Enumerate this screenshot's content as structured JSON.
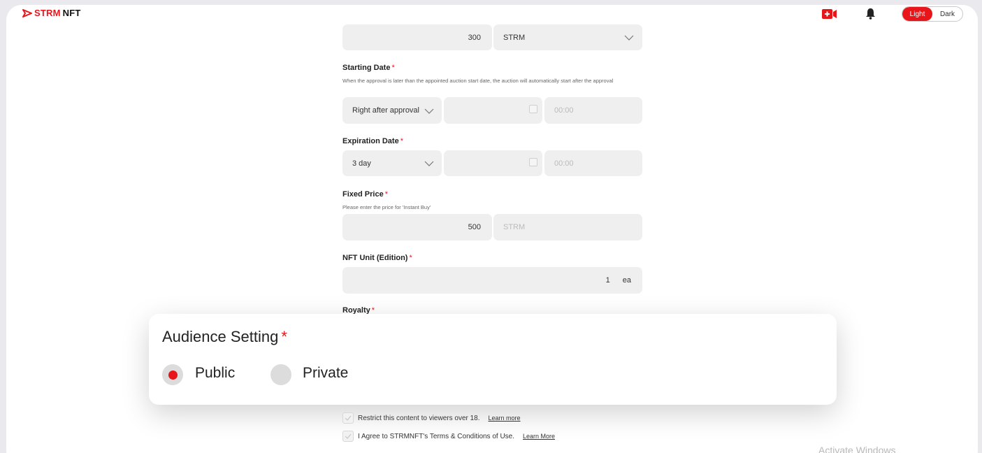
{
  "header": {
    "logo_part1": "STRM",
    "logo_part2": "NFT",
    "theme_light": "Light",
    "theme_dark": "Dark"
  },
  "colors": {
    "accent": "#e8151b",
    "field_bg": "#efefef"
  },
  "icons": [
    "play-logo-icon",
    "live-video-icon",
    "bell-icon",
    "chevron-down-icon",
    "calendar-icon",
    "check-icon"
  ],
  "form": {
    "price_top": {
      "value": "300",
      "currency": "STRM"
    },
    "starting_date": {
      "label": "Starting Date",
      "hint": "When the approval is later than the appointed auction start date, the auction will automatically start after the approval",
      "select": "Right after approval",
      "time": "00:00"
    },
    "expiration_date": {
      "label": "Expiration Date",
      "select": "3 day",
      "time": "00:00"
    },
    "fixed_price": {
      "label": "Fixed Price",
      "hint": "Please enter the price for 'Instant Buy'",
      "value": "500",
      "currency": "STRM"
    },
    "nft_unit": {
      "label": "NFT Unit (Edition)",
      "value": "1",
      "unit": "ea"
    },
    "royalty": {
      "label": "Royalty"
    },
    "required_mark": "*"
  },
  "audience": {
    "title": "Audience Setting",
    "options": [
      {
        "label": "Public",
        "selected": true
      },
      {
        "label": "Private",
        "selected": false
      }
    ]
  },
  "checks": {
    "restrict": {
      "text": "Restrict this content to viewers over 18.",
      "link": "Learn more"
    },
    "agree": {
      "text": "I Agree to STRMNFT's Terms & Conditions of Use.",
      "link": "Learn More"
    }
  },
  "watermark": "Activate Windows"
}
